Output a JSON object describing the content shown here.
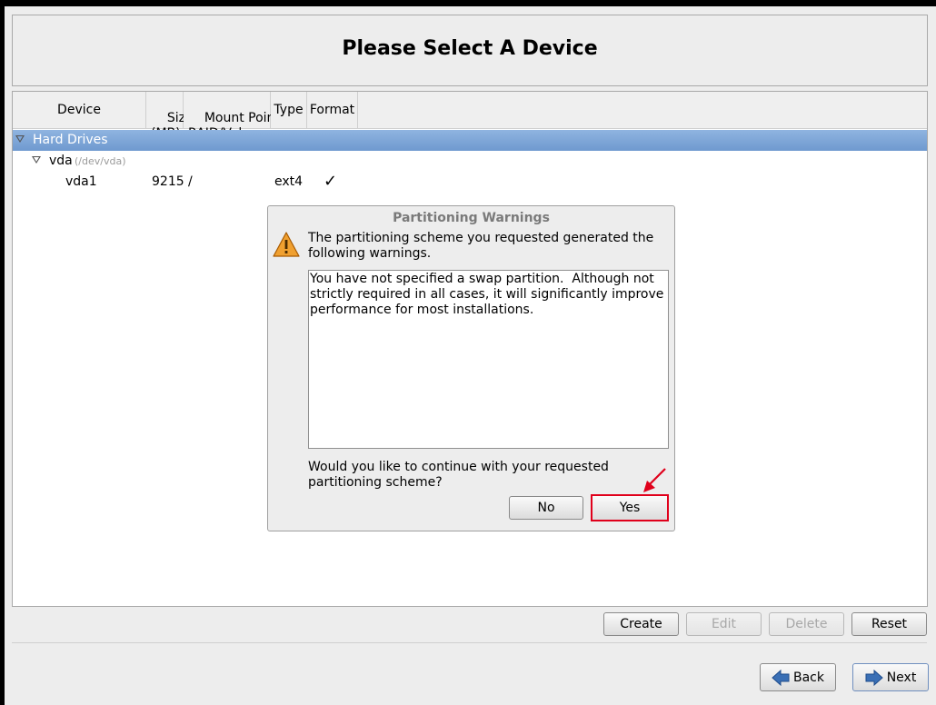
{
  "header": {
    "title": "Please Select A Device"
  },
  "columns": [
    {
      "label": "Device"
    },
    {
      "label": "Size\n(MB)"
    },
    {
      "label": "Mount Point/\nRAID/Volume"
    },
    {
      "label": "Type"
    },
    {
      "label": "Format"
    }
  ],
  "tree": {
    "group_label": "Hard Drives",
    "disk": {
      "name": "vda",
      "path": "(/dev/vda)"
    },
    "partition": {
      "device": "vda1",
      "size": "9215",
      "mount": "/",
      "type": "ext4",
      "format": "✓"
    }
  },
  "dialog": {
    "title": "Partitioning Warnings",
    "message": "The partitioning scheme you requested generated the following warnings.",
    "warnings_text": "You have not specified a swap partition.  Although not strictly required in all cases, it will significantly improve performance for most installations.",
    "question": "Would you like to continue with your requested partitioning scheme?",
    "no_label": "No",
    "yes_label": "Yes"
  },
  "actions": {
    "create": "Create",
    "edit": "Edit",
    "delete": "Delete",
    "reset": "Reset"
  },
  "nav": {
    "back": "Back",
    "next": "Next"
  },
  "colors": {
    "selection": "#7ea6d8",
    "highlight": "#e0001b",
    "warning": "#f0a030",
    "nav_arrow": "#3a6fb5"
  }
}
